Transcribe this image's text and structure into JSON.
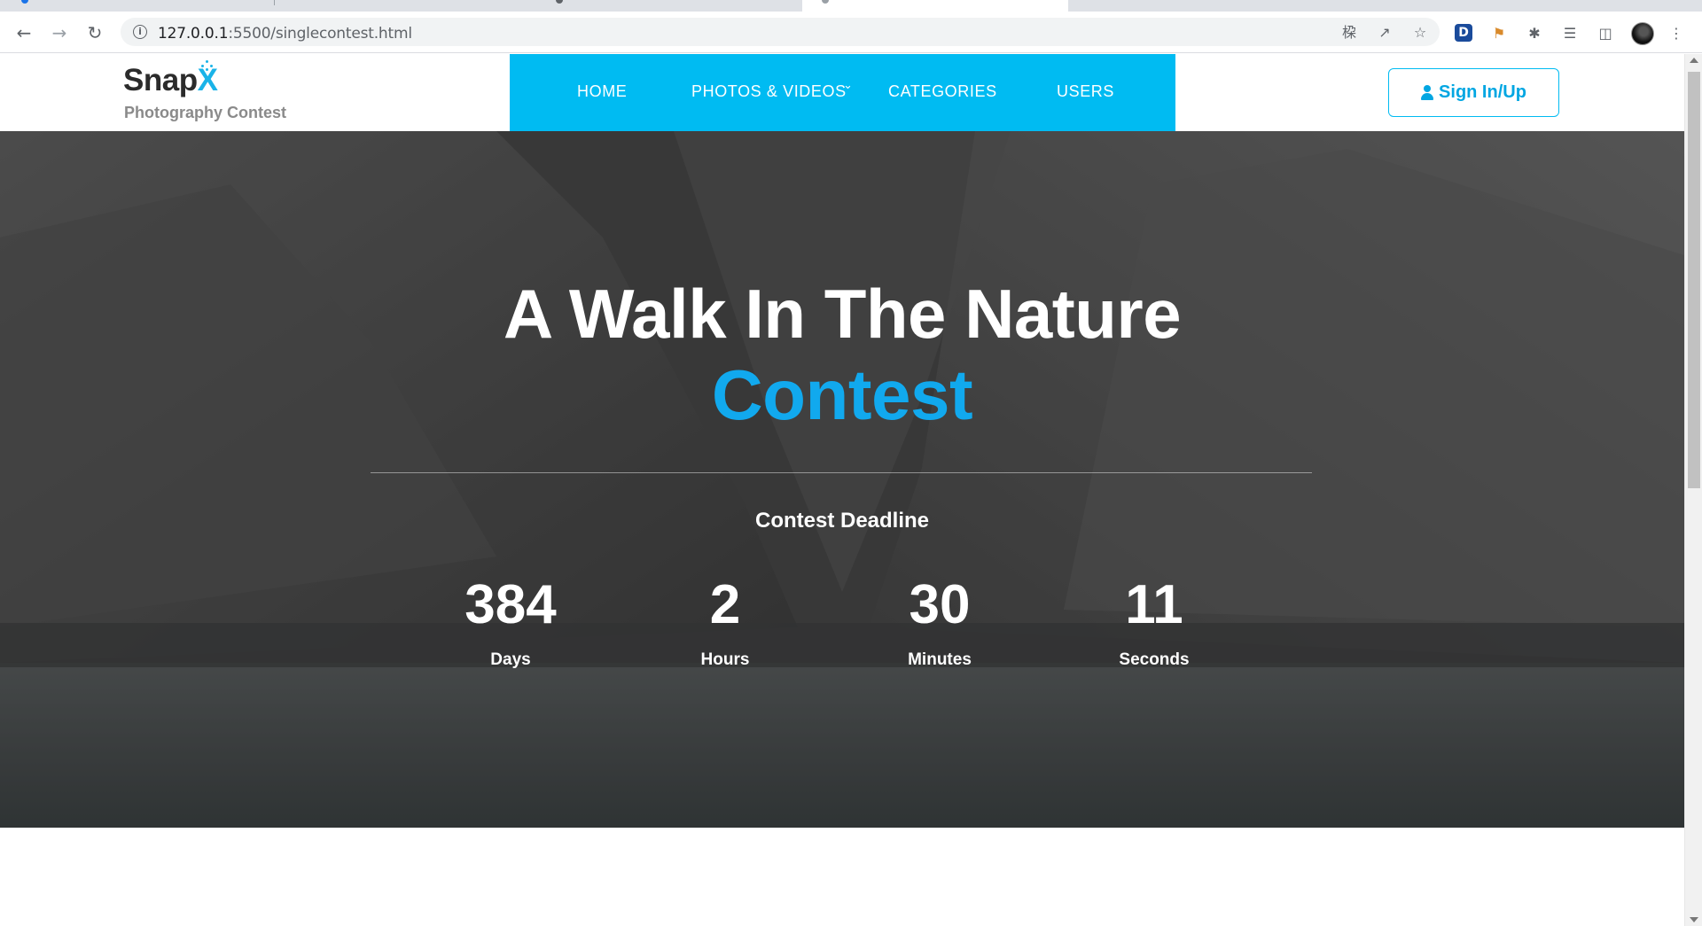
{
  "browser": {
    "url_host": "127.0.0.1",
    "url_path": ":5500/singlecontest.html",
    "nav_icons": [
      "back-arrow-icon",
      "forward-arrow-icon",
      "reload-icon"
    ],
    "omnibox_icons": [
      "info-icon",
      "translate-icon",
      "share-icon",
      "star-icon"
    ],
    "extension_icons": [
      "d-extension-icon",
      "pin-extension-icon",
      "puzzle-icon",
      "media-queue-icon",
      "sidepanel-icon",
      "profile-avatar",
      "kebab-menu-icon"
    ],
    "extension_d_label": "D"
  },
  "header": {
    "logo_text": "Snap",
    "logo_accent": "X",
    "logo_subtitle": "Photography Contest",
    "nav": [
      {
        "label": "HOME"
      },
      {
        "label": "PHOTOS & VIDEOS"
      },
      {
        "label": "CATEGORIES"
      },
      {
        "label": "USERS"
      }
    ],
    "signin_label": "Sign In/Up",
    "accent_color": "#00bbf2"
  },
  "hero": {
    "title": "A Walk In The Nature",
    "accent": "Contest",
    "deadline_label": "Contest Deadline",
    "countdown": [
      {
        "value": "384",
        "unit": "Days"
      },
      {
        "value": "2",
        "unit": "Hours"
      },
      {
        "value": "30",
        "unit": "Minutes"
      },
      {
        "value": "11",
        "unit": "Seconds"
      }
    ]
  }
}
